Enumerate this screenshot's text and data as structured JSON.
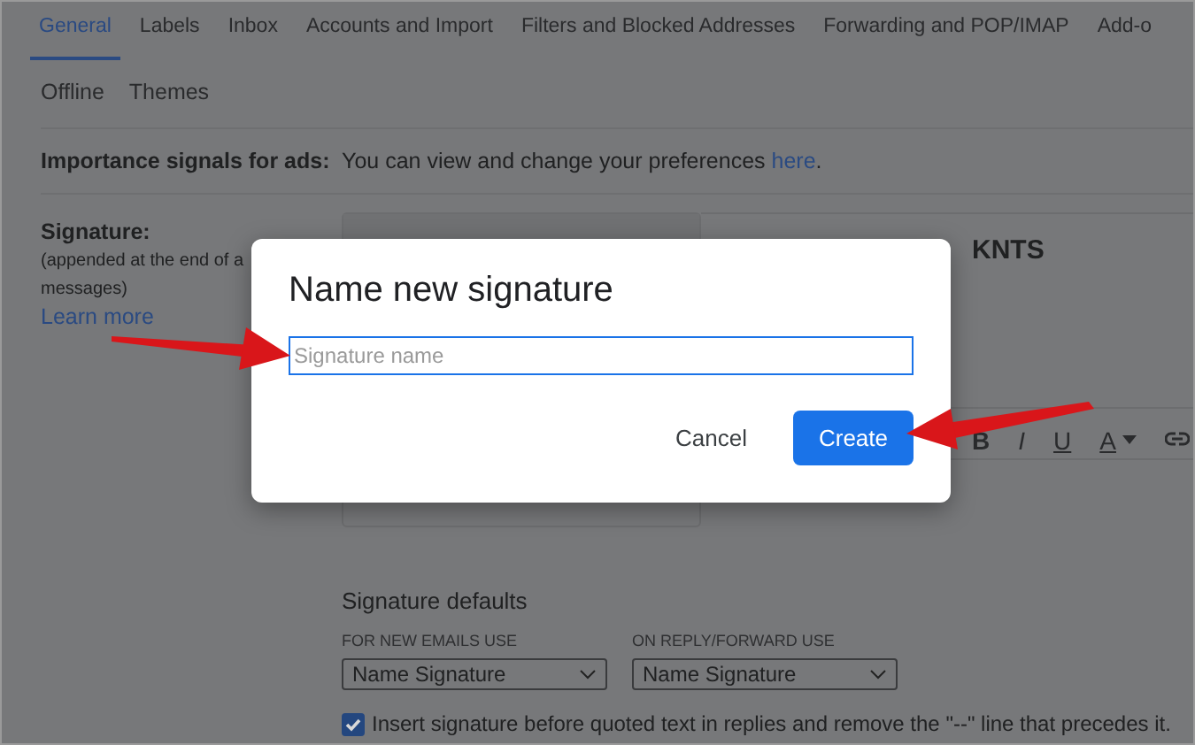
{
  "tabs": [
    {
      "label": "General",
      "selected": true
    },
    {
      "label": "Labels",
      "selected": false
    },
    {
      "label": "Inbox",
      "selected": false
    },
    {
      "label": "Accounts and Import",
      "selected": false
    },
    {
      "label": "Filters and Blocked Addresses",
      "selected": false
    },
    {
      "label": "Forwarding and POP/IMAP",
      "selected": false
    },
    {
      "label": "Add-o",
      "selected": false
    },
    {
      "label": "Offline",
      "selected": false
    },
    {
      "label": "Themes",
      "selected": false
    }
  ],
  "importance": {
    "label": "Importance signals for ads:",
    "text": "You can view and change your preferences ",
    "link": "here",
    "end": "."
  },
  "signature": {
    "label": "Signature:",
    "note": "(appended at the end of a",
    "note2": "messages)",
    "learn_more": "Learn more",
    "sender": "KNTS",
    "toolbar": [
      {
        "glyph": "B",
        "kind": "bold"
      },
      {
        "glyph": "I",
        "kind": "italic"
      },
      {
        "glyph": "U",
        "kind": "underline"
      },
      {
        "glyph": "A",
        "kind": "color"
      }
    ]
  },
  "defaults": {
    "title": "Signature defaults",
    "new_label": "FOR NEW EMAILS USE",
    "new_value": "Name Signature",
    "reply_label": "ON REPLY/FORWARD USE",
    "reply_value": "Name Signature",
    "insert_checked": true,
    "insert_text": "Insert signature before quoted text in replies and remove the \"--\" line that precedes it."
  },
  "dialog": {
    "title": "Name new signature",
    "placeholder": "Signature name",
    "cancel": "Cancel",
    "create": "Create"
  }
}
